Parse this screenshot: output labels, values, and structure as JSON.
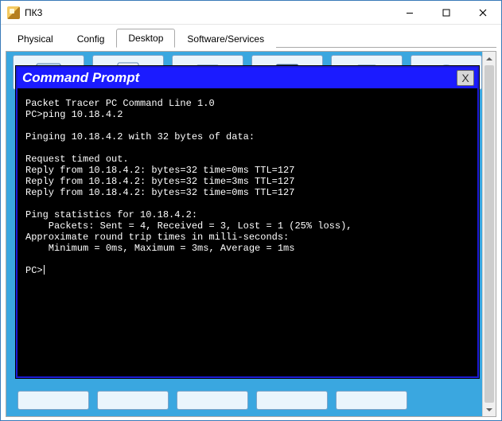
{
  "window": {
    "title": "ПК3",
    "controls": {
      "min": "–",
      "max": "□",
      "close": "✕"
    }
  },
  "tabs": [
    {
      "label": "Physical",
      "active": false
    },
    {
      "label": "Config",
      "active": false
    },
    {
      "label": "Desktop",
      "active": true
    },
    {
      "label": "Software/Services",
      "active": false
    }
  ],
  "cmd": {
    "title": "Command Prompt",
    "close_label": "X",
    "lines": [
      "Packet Tracer PC Command Line 1.0",
      "PC>ping 10.18.4.2",
      "",
      "Pinging 10.18.4.2 with 32 bytes of data:",
      "",
      "Request timed out.",
      "Reply from 10.18.4.2: bytes=32 time=0ms TTL=127",
      "Reply from 10.18.4.2: bytes=32 time=3ms TTL=127",
      "Reply from 10.18.4.2: bytes=32 time=0ms TTL=127",
      "",
      "Ping statistics for 10.18.4.2:",
      "    Packets: Sent = 4, Received = 3, Lost = 1 (25% loss),",
      "Approximate round trip times in milli-seconds:",
      "    Minimum = 0ms, Maximum = 3ms, Average = 1ms",
      "",
      "PC>"
    ],
    "prompt": "PC>"
  },
  "icons": {
    "minimize": "minimize-icon",
    "maximize": "maximize-icon",
    "close": "close-icon",
    "shield": "app-icon"
  }
}
